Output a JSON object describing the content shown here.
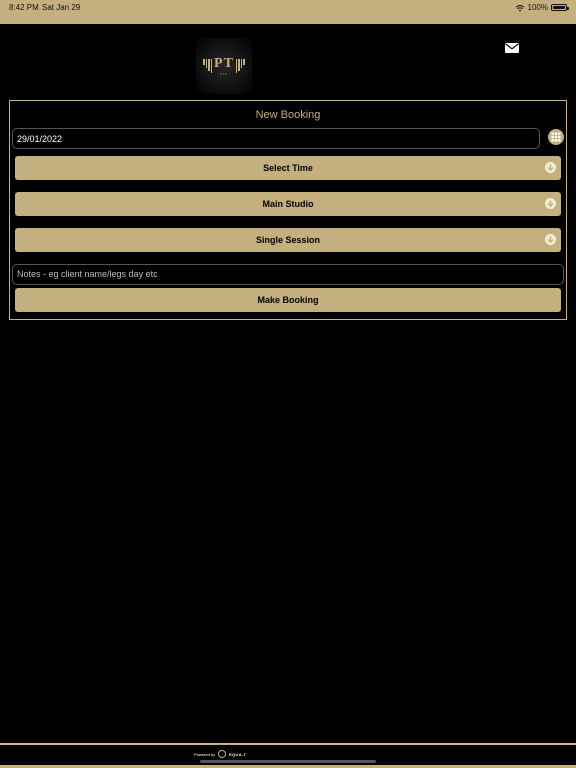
{
  "status_bar": {
    "time": "8:42 PM",
    "date": "Sat Jan 29",
    "battery": "100%"
  },
  "header": {
    "logo_text": "PT",
    "logo_subtext": "FIT",
    "mail_icon": "envelope-icon"
  },
  "booking": {
    "title": "New Booking",
    "date_value": "29/01/2022",
    "select_time_label": "Select Time",
    "studio_label": "Main Studio",
    "session_label": "Single Session",
    "notes_placeholder": "Notes - eg client name/legs day etc",
    "make_booking_label": "Make Booking"
  },
  "footer": {
    "powered_by": "Powered by",
    "brand": "EQUA-T"
  },
  "colors": {
    "accent": "#c4b07f",
    "background": "#000000"
  }
}
